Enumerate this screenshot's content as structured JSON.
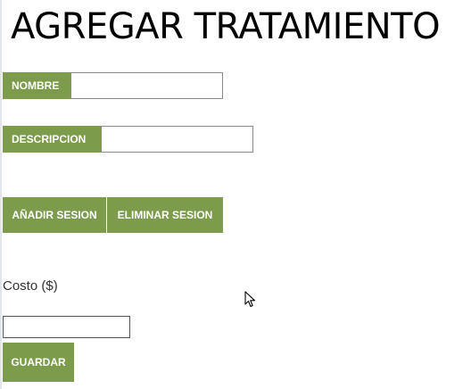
{
  "page": {
    "title": "AGREGAR TRATAMIENTO"
  },
  "form": {
    "nombre": {
      "label": "NOMBRE",
      "value": ""
    },
    "descripcion": {
      "label": "DESCRIPCION",
      "value": ""
    },
    "add_session_label": "AÑADIR SESION",
    "remove_session_label": "ELIMINAR SESION",
    "costo": {
      "label": "Costo ($)",
      "value": ""
    },
    "save_label": "GUARDAR"
  },
  "theme": {
    "accent": "#7c9c4c",
    "text": "#000000"
  },
  "icons": {
    "pointer": "mouse-pointer-icon"
  }
}
